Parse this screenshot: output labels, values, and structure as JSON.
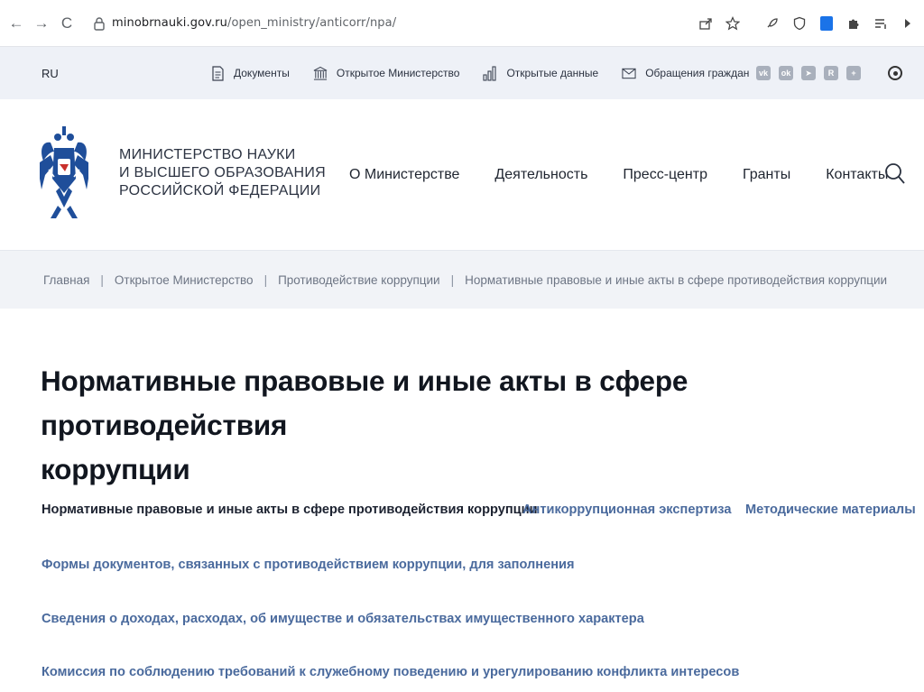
{
  "browser": {
    "url_host": "minobrnauki.gov.ru",
    "url_path": "/open_ministry/anticorr/npa/",
    "back_glyph": "←",
    "forward_glyph": "→",
    "reload_glyph": "C"
  },
  "utility_bar": {
    "language": "RU",
    "links": [
      {
        "label": "Документы",
        "icon": "document-icon"
      },
      {
        "label": "Открытое Министерство",
        "icon": "building-icon"
      },
      {
        "label": "Открытые данные",
        "icon": "bar-chart-icon"
      },
      {
        "label": "Обращения граждан",
        "icon": "envelope-icon"
      }
    ],
    "socials": [
      {
        "icon": "vk-icon",
        "glyph": "vk"
      },
      {
        "icon": "ok-icon",
        "glyph": "ok"
      },
      {
        "icon": "telegram-icon",
        "glyph": "➤"
      },
      {
        "icon": "rutube-icon",
        "glyph": "R"
      },
      {
        "icon": "plus-icon",
        "glyph": "+"
      }
    ]
  },
  "header": {
    "ministry_name_line1": "Министерство науки",
    "ministry_name_line2": "и высшего образования",
    "ministry_name_line3": "Российской Федерации",
    "nav": [
      "О Министерстве",
      "Деятельность",
      "Пресс-центр",
      "Гранты",
      "Контакты"
    ]
  },
  "breadcrumb": {
    "items": [
      "Главная",
      "Открытое Министерство",
      "Противодействие коррупции",
      "Нормативные правовые и иные акты в сфере противодействия коррупции"
    ],
    "separator": "|"
  },
  "main": {
    "title_line1": "Нормативные правовые и иные акты в сфере противодействия",
    "title_line2": "коррупции",
    "sections": [
      "Нормативные правовые и иные акты в сфере противодействия коррупции",
      "Антикоррупционная экспертиза",
      "Методические материалы",
      "Формы документов, связанных с противодействием коррупции, для заполнения",
      "Сведения о доходах, расходах, об имуществе и обязательствах имущественного характера",
      "Комиссия по соблюдению требований к служебному поведению и урегулированию конфликта интересов"
    ]
  },
  "colors": {
    "link": "#4a6a9d",
    "utility_bg": "#eef1f7",
    "breadcrumb_bg": "#f1f3f7",
    "emblem_blue": "#1f4e9a"
  }
}
